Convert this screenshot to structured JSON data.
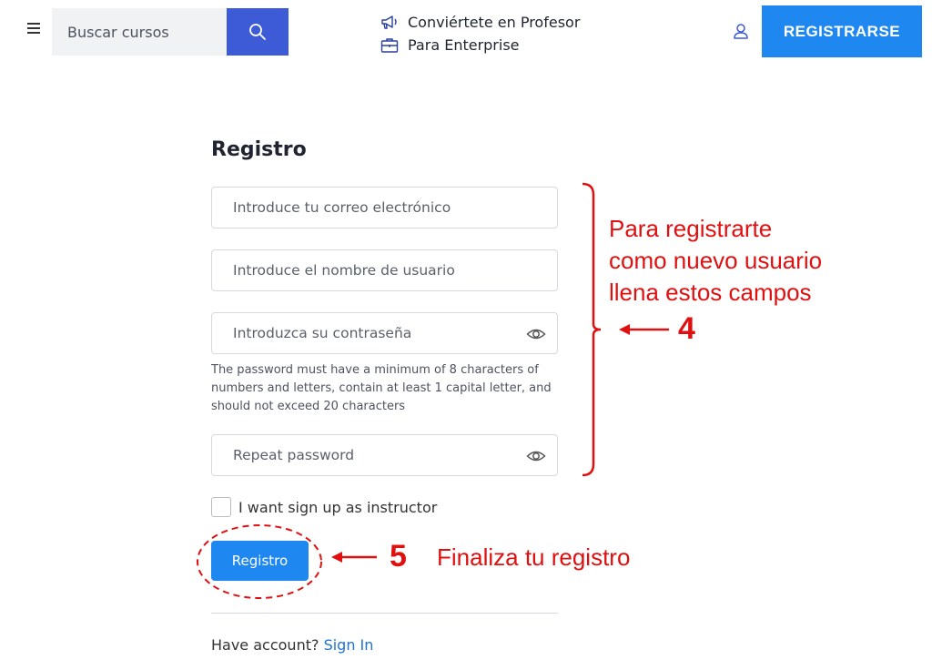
{
  "header": {
    "search": {
      "placeholder": "Buscar cursos"
    },
    "nav": [
      {
        "label": "Conviértete en Profesor",
        "icon": "megaphone-icon"
      },
      {
        "label": "Para Enterprise",
        "icon": "briefcase-icon"
      }
    ],
    "register_label": "REGISTRARSE"
  },
  "form": {
    "title": "Registro",
    "email_placeholder": "Introduce tu correo electrónico",
    "username_placeholder": "Introduce el nombre de usuario",
    "password_placeholder": "Introduzca su contraseña",
    "password_hint": "The password must have a minimum of 8 characters of numbers and letters, contain at least 1 capital letter, and should not exceed 20 characters",
    "repeat_placeholder": "Repeat password",
    "instructor_label": "I want sign up as instructor",
    "instructor_checked": false,
    "submit_label": "Registro",
    "have_account": "Have account?",
    "sign_in": "Sign In"
  },
  "annotations": {
    "fields_note_lines": [
      "Para registrarte",
      "como nuevo usuario",
      "llena estos campos"
    ],
    "fields_step": "4",
    "submit_step": "5",
    "submit_note": "Finaliza tu registro"
  },
  "colors": {
    "accent": "#1e88f0",
    "search_button": "#3d5bd6",
    "annotation": "#e01010"
  }
}
